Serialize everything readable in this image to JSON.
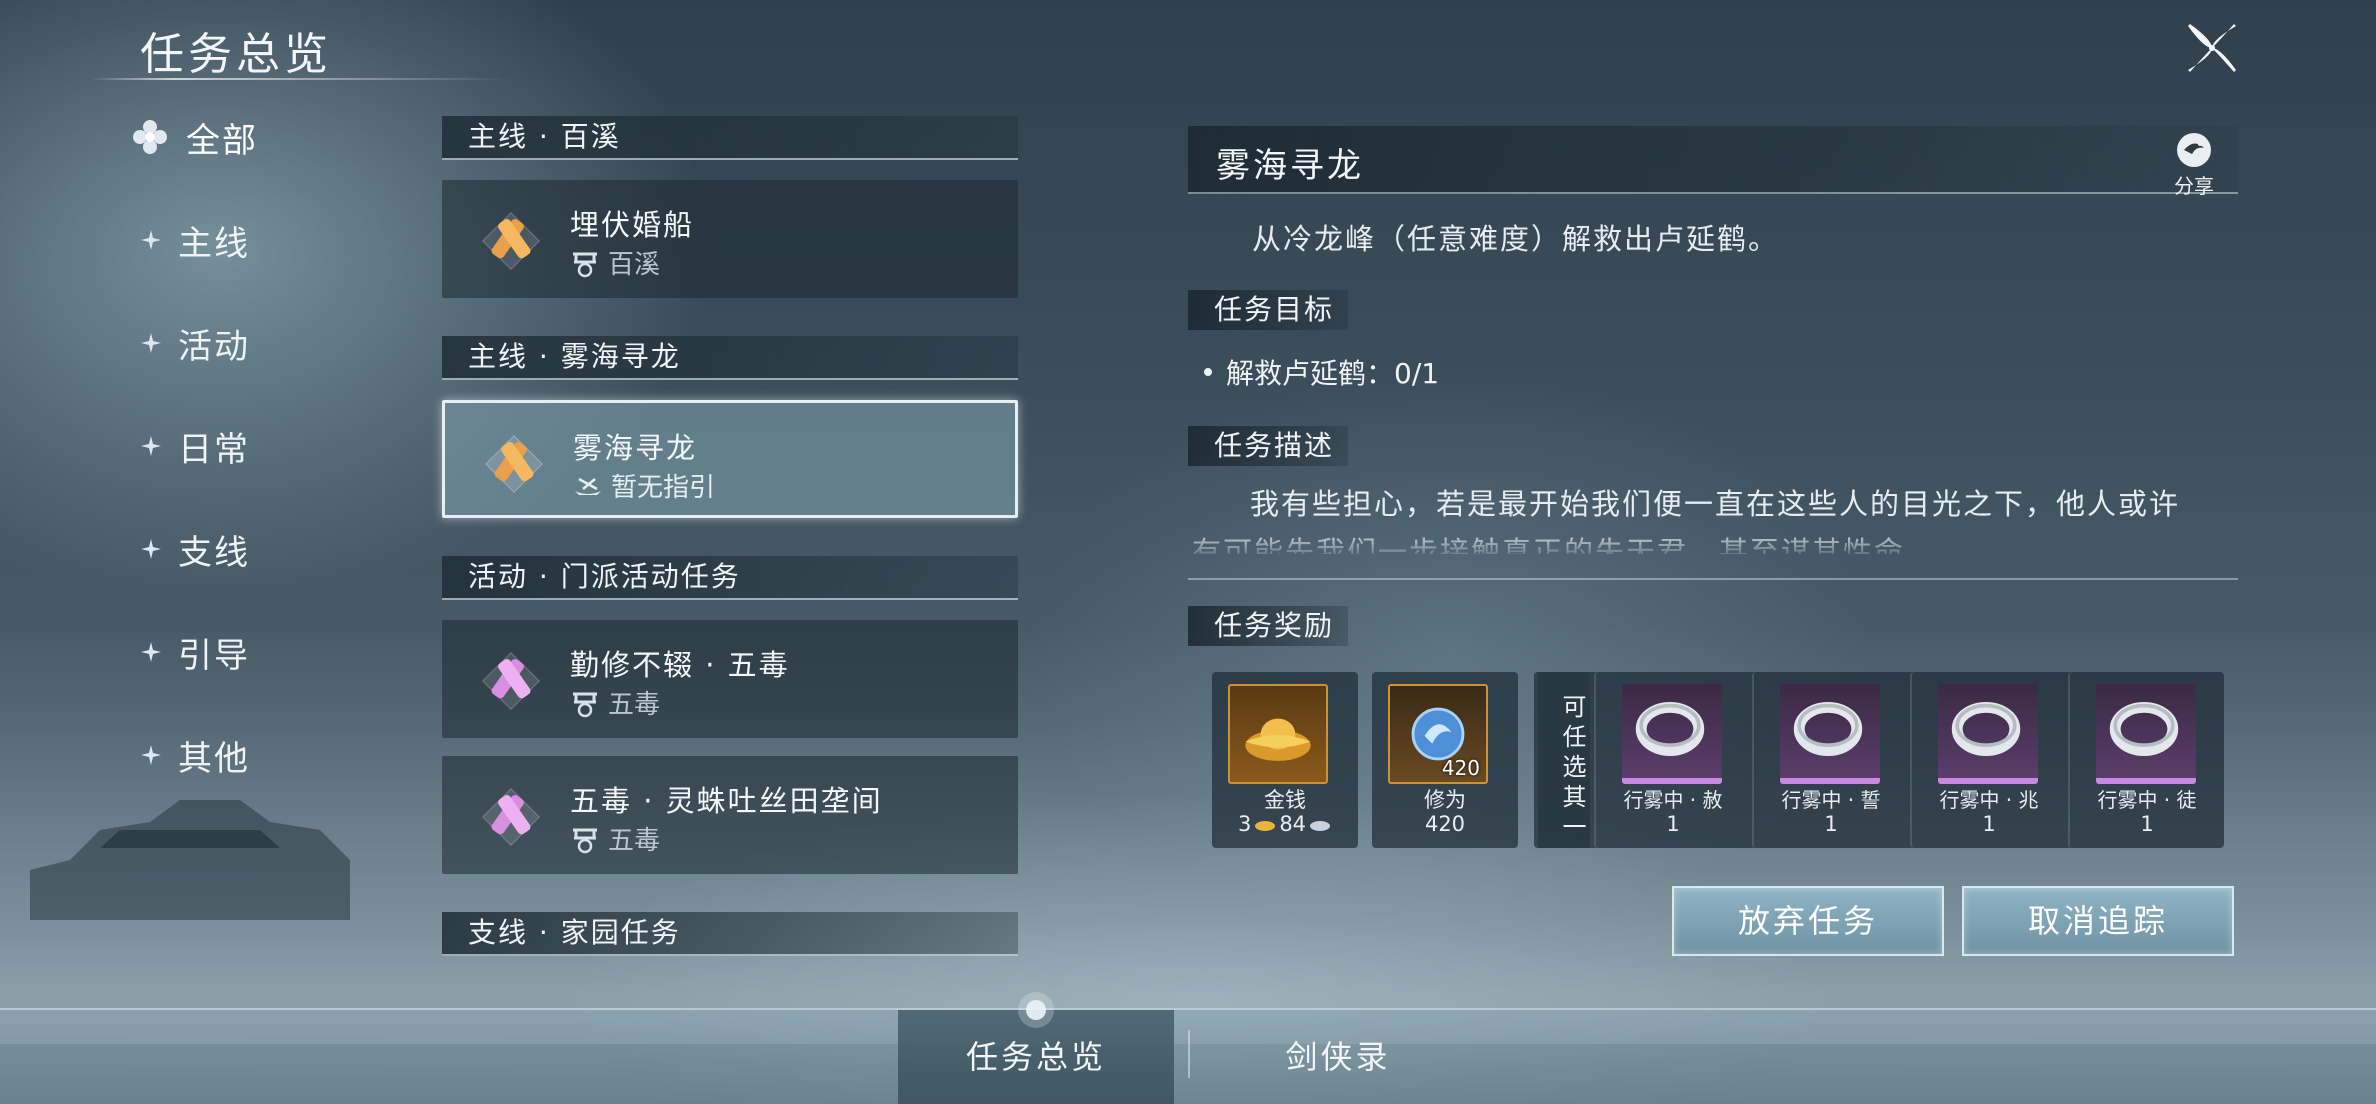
{
  "header": {
    "title": "任务总览"
  },
  "categories": [
    {
      "label": "全部",
      "active": true
    },
    {
      "label": "主线"
    },
    {
      "label": "活动"
    },
    {
      "label": "日常"
    },
    {
      "label": "支线"
    },
    {
      "label": "引导"
    },
    {
      "label": "其他"
    }
  ],
  "quest_groups": [
    {
      "title": "主线 · 百溪",
      "quests": [
        {
          "name": "埋伏婚船",
          "location": "百溪",
          "icon": "scroll-icon-orange"
        }
      ]
    },
    {
      "title": "主线 · 雾海寻龙",
      "quests": [
        {
          "name": "雾海寻龙",
          "location": "暂无指引",
          "icon": "scroll-icon-orange",
          "selected": true
        }
      ]
    },
    {
      "title": "活动 · 门派活动任务",
      "quests": [
        {
          "name": "勤修不辍 · 五毒",
          "location": "五毒",
          "icon": "scroll-icon-pink"
        },
        {
          "name": "五毒 · 灵蛛吐丝田垄间",
          "location": "五毒",
          "icon": "scroll-icon-pink"
        }
      ]
    },
    {
      "title": "支线 · 家园任务",
      "quests": []
    }
  ],
  "detail": {
    "title": "雾海寻龙",
    "share_label": "分享",
    "summary": "从冷龙峰（任意难度）解救出卢延鹤。",
    "objective_label": "任务目标",
    "objective": "解救卢延鹤：0/1",
    "description_label": "任务描述",
    "description": "我有些担心，若是最开始我们便一直在这些人的目光之下，他人或许有可能先我们一步接触真正的朱天君，甚至谋其性命。",
    "rewards_label": "任务奖励",
    "rewards": [
      {
        "label": "金钱",
        "amount_gold": "3",
        "amount_silver": "84",
        "icon": "gold-ingot-icon"
      },
      {
        "label": "修为",
        "amount": "420",
        "qty_badge": "420",
        "icon": "cultivation-orb-icon"
      }
    ],
    "choice_label": "可任选其一",
    "choices": [
      {
        "label": "行雾中 · 赦",
        "amount": "1",
        "icon": "ring-icon"
      },
      {
        "label": "行雾中 · 誓",
        "amount": "1",
        "icon": "ring-icon"
      },
      {
        "label": "行雾中 · 兆",
        "amount": "1",
        "icon": "ring-icon"
      },
      {
        "label": "行雾中 · 徒",
        "amount": "1",
        "icon": "ring-icon"
      }
    ],
    "abandon_label": "放弃任务",
    "untrack_label": "取消追踪"
  },
  "tabs": [
    {
      "label": "任务总览",
      "active": true
    },
    {
      "label": "剑侠录"
    }
  ]
}
